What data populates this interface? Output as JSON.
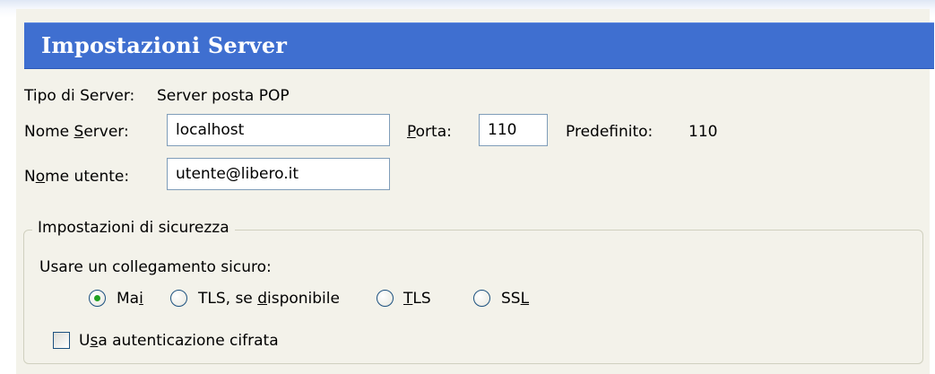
{
  "header": {
    "title": "Impostazioni Server"
  },
  "server_type": {
    "label": "Tipo di Server:",
    "value": "Server posta POP"
  },
  "server_name": {
    "label_pre": "Nome ",
    "label_key": "S",
    "label_post": "erver:",
    "value": "localhost"
  },
  "port": {
    "label_key": "P",
    "label_post": "orta:",
    "value": "110",
    "default_label": "Predefinito:",
    "default_value": "110"
  },
  "username": {
    "label_pre": "N",
    "label_key": "o",
    "label_post": "me utente:",
    "value": "utente@libero.it"
  },
  "security": {
    "legend": "Impostazioni di sicurezza",
    "prompt": "Usare un collegamento sicuro:",
    "options": [
      {
        "pre": "Ma",
        "key": "i",
        "post": "",
        "checked": true
      },
      {
        "pre": "TLS, se ",
        "key": "d",
        "post": "isponibile",
        "checked": false
      },
      {
        "pre": "",
        "key": "T",
        "post": "LS",
        "checked": false
      },
      {
        "pre": "SS",
        "key": "L",
        "post": "",
        "checked": false
      }
    ],
    "encrypted_auth": {
      "pre": "U",
      "key": "s",
      "post": "a autenticazione cifrata",
      "checked": false
    }
  },
  "colors": {
    "header_bg": "#3f6fd0",
    "panel_bg": "#f3f2ea",
    "radio_dot": "#21a121"
  }
}
